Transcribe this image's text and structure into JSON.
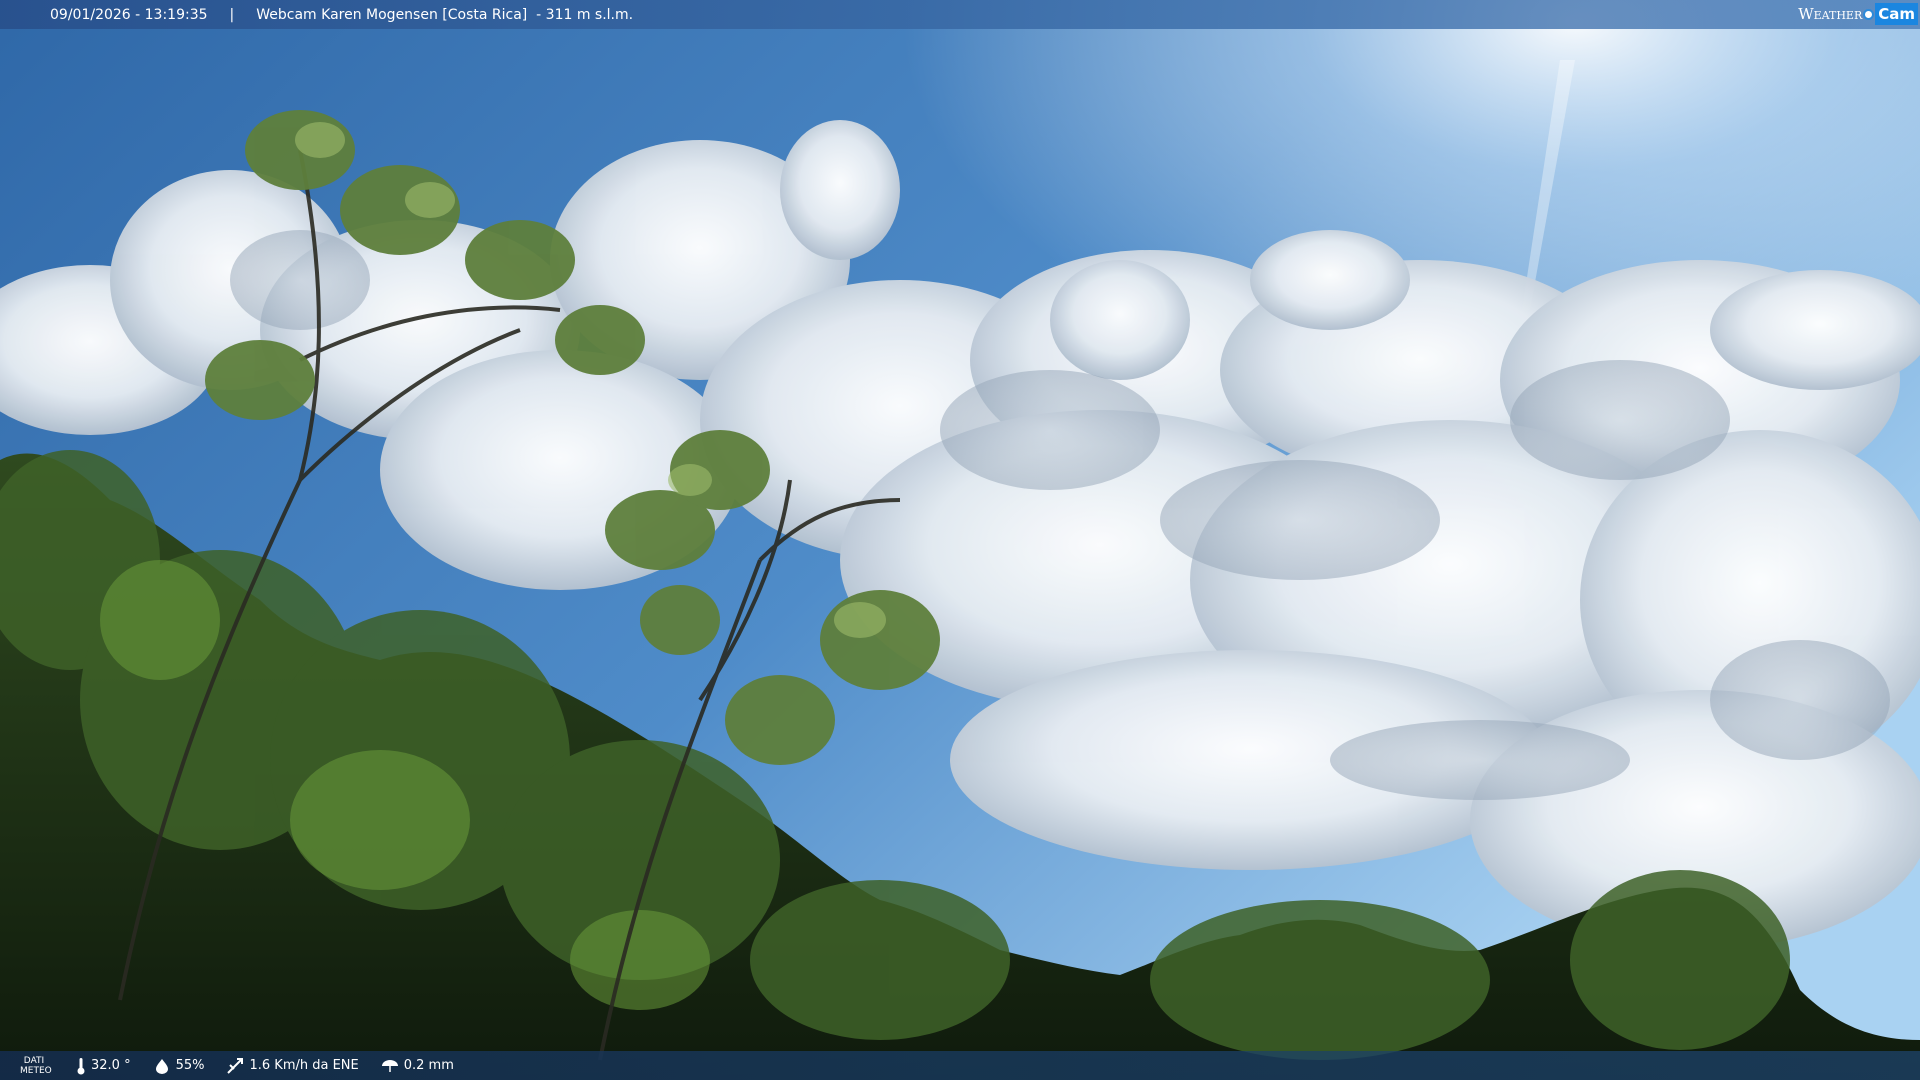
{
  "header": {
    "timestamp": "09/01/2026 - 13:19:35",
    "separator": "|",
    "title": "Webcam Karen Mogensen [Costa Rica]  - 311 m s.l.m.",
    "logo": {
      "weather": "Weather",
      "cam": "Cam"
    }
  },
  "footer": {
    "label_line1": "DATI",
    "label_line2": "METEO",
    "temperature": "32.0 °",
    "humidity": "55%",
    "wind": "1.6 Km/h da ENE",
    "rain": "0.2 mm",
    "icons": [
      "thermometer-icon",
      "humidity-icon",
      "wind-icon",
      "rain-icon"
    ]
  },
  "colors": {
    "sky": "#4a7fb8",
    "bar": "#2d5a8e",
    "logo_accent": "#1b86e0"
  }
}
